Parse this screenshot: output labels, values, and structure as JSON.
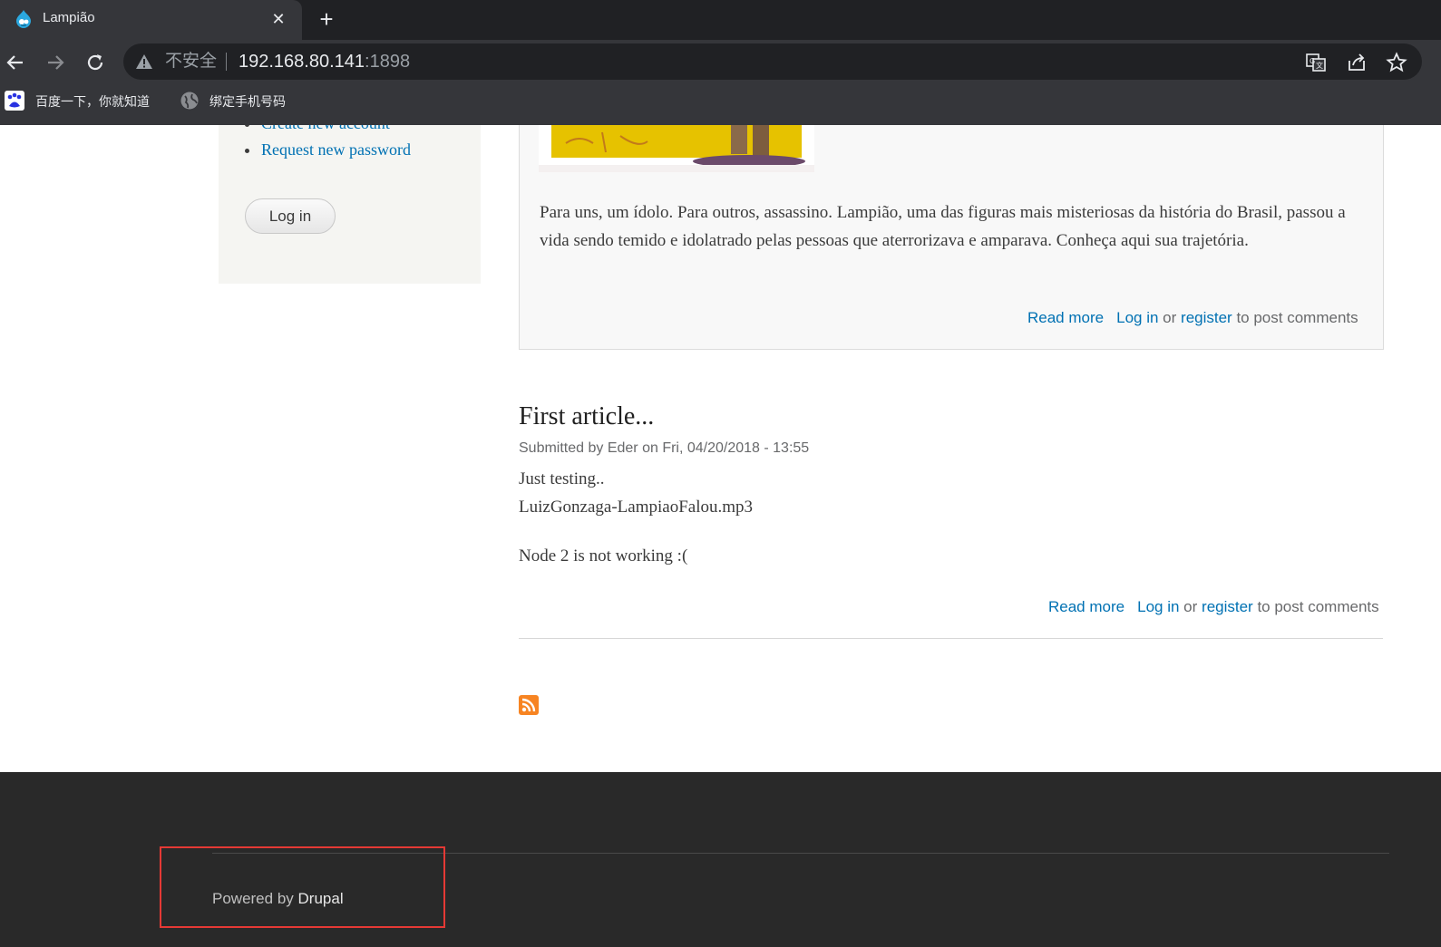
{
  "browser": {
    "tab_title": "Lampião",
    "tab_close": "✕",
    "new_tab": "+",
    "insecure_label": "不安全",
    "url_host": "192.168.80.141",
    "url_port": ":1898",
    "bookmarks": [
      {
        "label": "百度一下，你就知道",
        "icon": "baidu-icon"
      },
      {
        "label": "绑定手机号码",
        "icon": "globe-icon"
      }
    ]
  },
  "sidebar": {
    "links": [
      "Create new account",
      "Request new password"
    ],
    "login_button": "Log in"
  },
  "node1": {
    "body": "Para uns, um ídolo. Para outros, assassino. Lampião, uma das figuras mais misteriosas da história do Brasil, passou a vida sendo temido e idolatrado pelas pessoas que aterrorizava e amparava. Conheça aqui sua trajetória.",
    "read_more": "Read more",
    "login": "Log in",
    "or": "or",
    "register": "register",
    "post_comments": "to post comments"
  },
  "node2": {
    "title": "First article...",
    "meta": "Submitted by Eder on Fri, 04/20/2018 - 13:55",
    "lines": [
      "Just testing..",
      "LuizGonzaga-LampiaoFalou.mp3",
      "Node 2 is not working :("
    ],
    "read_more": "Read more",
    "login": "Log in",
    "or": "or",
    "register": "register",
    "post_comments": "to post comments"
  },
  "footer": {
    "powered_by": "Powered by",
    "drupal": "Drupal"
  },
  "colors": {
    "link": "#0071b3",
    "footer_bg": "#292929",
    "highlight_box": "#e53935"
  }
}
